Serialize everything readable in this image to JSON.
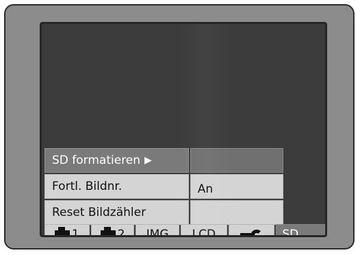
{
  "menu": {
    "items": [
      {
        "label": "SD formatieren",
        "value": "",
        "selected": true,
        "has_submenu": true
      },
      {
        "label": "Fortl. Bildnr.",
        "value": "An",
        "selected": false
      },
      {
        "label": "Reset Bildzähler",
        "value": "",
        "selected": false
      }
    ],
    "submenu_arrow": "▶"
  },
  "tabs": [
    {
      "icon": "camera-icon",
      "label": "1",
      "active": false
    },
    {
      "icon": "camera-icon",
      "label": "2",
      "active": false
    },
    {
      "label": "IMG",
      "active": false
    },
    {
      "label": "LCD",
      "active": false
    },
    {
      "icon": "wrench-icon",
      "label": "",
      "active": false
    },
    {
      "label": "SD",
      "active": true
    }
  ],
  "colors": {
    "bezel": "#8c8c8c",
    "screen": "#3c3c3c",
    "item_normal": "#d4d4d4",
    "item_selected": "#7a7a7a"
  }
}
